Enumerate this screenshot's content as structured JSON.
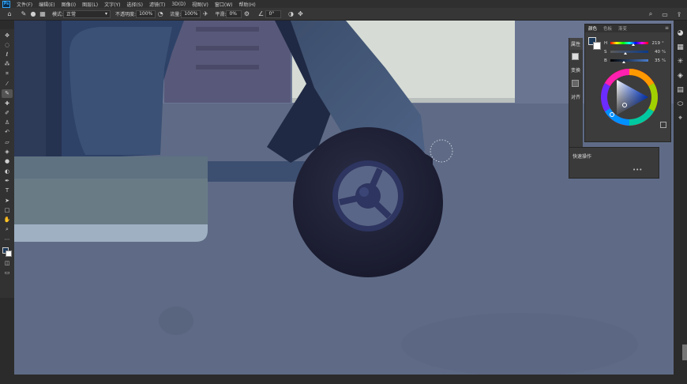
{
  "menubar": {
    "app_icon": "photoshop-icon",
    "app_icon_label": "Ps",
    "items": [
      "文件(F)",
      "编辑(E)",
      "图像(I)",
      "图层(L)",
      "文字(Y)",
      "选择(S)",
      "滤镜(T)",
      "3D(D)",
      "视图(V)",
      "窗口(W)",
      "帮助(H)"
    ]
  },
  "options": {
    "mode_label": "模式:",
    "mode_value": "正常",
    "opacity_label": "不透明度:",
    "opacity_value": "100%",
    "flow_label": "流量:",
    "flow_value": "100%",
    "smoothing_label": "平滑:",
    "smoothing_value": "0%",
    "angle_value": "0°"
  },
  "toolbar": {
    "tools": [
      "move-icon",
      "marquee-icon",
      "lasso-icon",
      "quick-select-icon",
      "crop-icon",
      "eyedropper-icon",
      "brush-icon",
      "healing-brush-icon",
      "brush-tool-icon",
      "clone-stamp-icon",
      "history-brush-icon",
      "eraser-icon",
      "paint-bucket-icon",
      "blur-icon",
      "dodge-icon",
      "pen-icon",
      "type-icon",
      "path-select-icon",
      "rectangle-icon",
      "hand-icon",
      "zoom-icon",
      "more-tools-icon"
    ],
    "active_tool_index": 6,
    "foreground_color": "#1d3a5a",
    "background_color": "#ffffff"
  },
  "color_panel": {
    "tabs": [
      "颜色",
      "色板",
      "渐变"
    ],
    "active_tab": 0,
    "sliders": [
      {
        "label": "H",
        "value": "219",
        "unit": "°",
        "fraction": 0.61
      },
      {
        "label": "S",
        "value": "40",
        "unit": "%",
        "fraction": 0.4
      },
      {
        "label": "B",
        "value": "35",
        "unit": "%",
        "fraction": 0.35
      }
    ]
  },
  "properties_panel": {
    "tab": "属性",
    "section": "变换",
    "align_label": "对齐"
  },
  "quick_actions": {
    "title": "快速操作",
    "more": "•••"
  },
  "right_strip": {
    "icons": [
      "color-wheel-icon",
      "swatches-icon",
      "adjustments-icon",
      "layers-icon",
      "channels-icon",
      "paths-icon"
    ]
  },
  "colors": {
    "canvas_bg": "#5f6b86",
    "accent": "#31a8ff"
  }
}
